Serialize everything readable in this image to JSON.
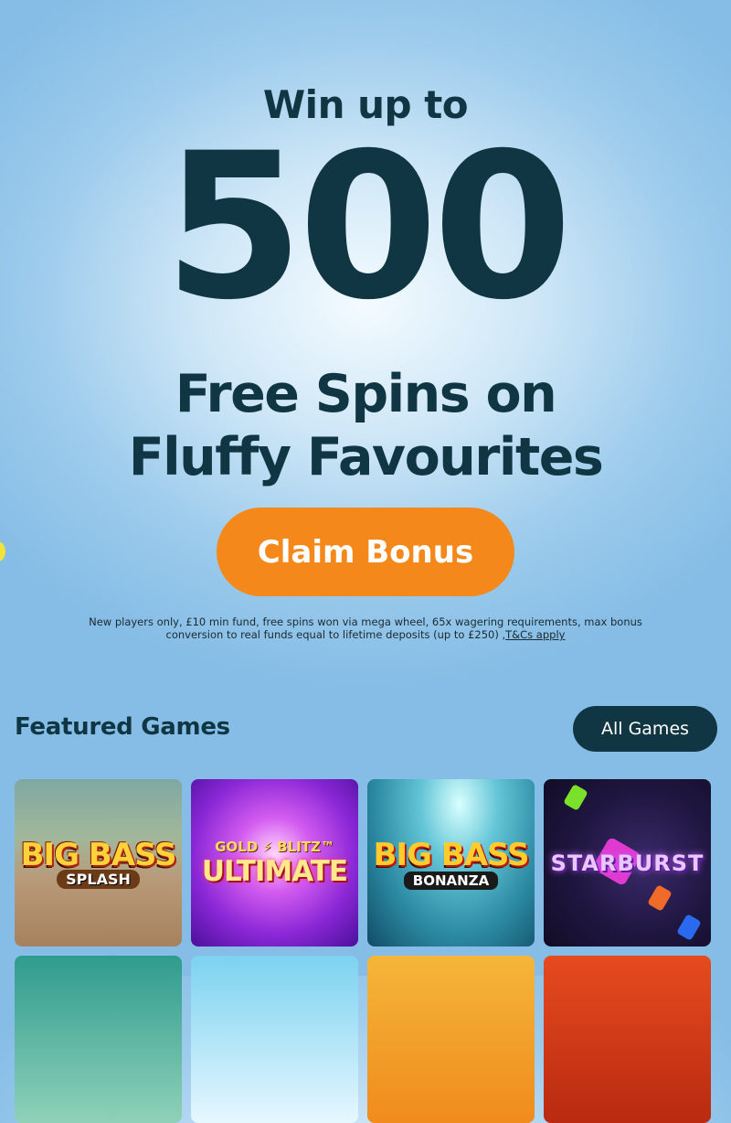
{
  "hero": {
    "win_up": "Win up to",
    "number": "500",
    "line1": "Free Spins on",
    "line2": "Fluffy Favourites",
    "claim_button": "Claim Bonus",
    "terms_text": "New players only, £10 min fund, free spins won via mega wheel, 65x wagering requirements, max bonus conversion to real funds equal to lifetime deposits (up to £250) ,",
    "terms_link": "T&Cs apply"
  },
  "featured": {
    "title": "Featured Games",
    "all_games_button": "All Games",
    "games": [
      {
        "line1": "BIG BASS",
        "line2": "SPLASH"
      },
      {
        "line1": "GOLD ⚡ BLITZ™",
        "line2": "ULTIMATE"
      },
      {
        "line1": "BIG BASS",
        "line2": "BONANZA"
      },
      {
        "line1": "STARBURST"
      }
    ]
  },
  "colors": {
    "accent_orange": "#f5881b",
    "dark_teal": "#0f3642",
    "background_blue": "#86bde6"
  }
}
